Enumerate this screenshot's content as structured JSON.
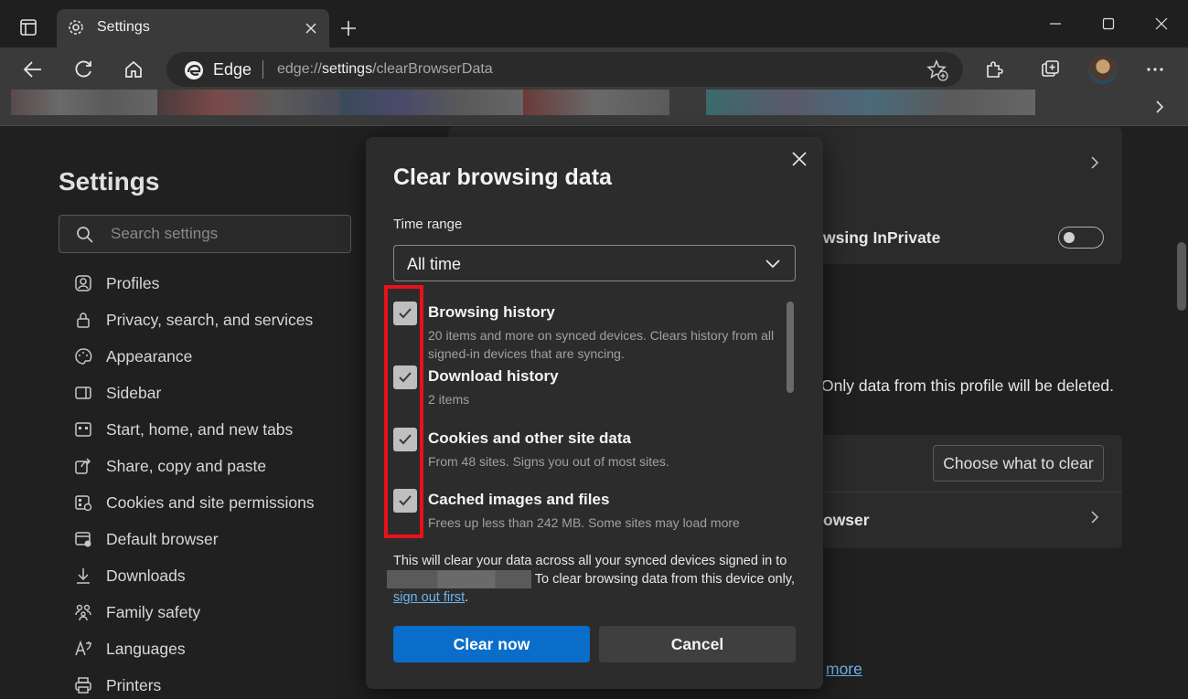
{
  "tab": {
    "title": "Settings"
  },
  "address_bar": {
    "site_name": "Edge",
    "url_prefix": "edge://",
    "url_path": "settings",
    "url_suffix": "/clearBrowserData"
  },
  "sidebar": {
    "title": "Settings",
    "search_placeholder": "Search settings",
    "items": [
      {
        "label": "Profiles",
        "icon": "profile-icon"
      },
      {
        "label": "Privacy, search, and services",
        "icon": "lock-icon"
      },
      {
        "label": "Appearance",
        "icon": "palette-icon"
      },
      {
        "label": "Sidebar",
        "icon": "sidebar-icon"
      },
      {
        "label": "Start, home, and new tabs",
        "icon": "home-grid-icon"
      },
      {
        "label": "Share, copy and paste",
        "icon": "share-icon"
      },
      {
        "label": "Cookies and site permissions",
        "icon": "cookies-icon"
      },
      {
        "label": "Default browser",
        "icon": "browser-icon"
      },
      {
        "label": "Downloads",
        "icon": "download-icon"
      },
      {
        "label": "Family safety",
        "icon": "family-icon"
      },
      {
        "label": "Languages",
        "icon": "language-icon"
      },
      {
        "label": "Printers",
        "icon": "printer-icon"
      }
    ]
  },
  "background": {
    "inprivate_label": "wsing InPrivate",
    "profile_note": "Only data from this profile will be deleted.",
    "choose_button": "Choose what to clear",
    "browser_row": "owser",
    "more_link": "more"
  },
  "dialog": {
    "title": "Clear browsing data",
    "time_range_label": "Time range",
    "time_range_value": "All time",
    "items": [
      {
        "title": "Browsing history",
        "desc": "20 items and more on synced devices. Clears history from all signed-in devices that are syncing.",
        "checked": true
      },
      {
        "title": "Download history",
        "desc": "2 items",
        "checked": true
      },
      {
        "title": "Cookies and other site data",
        "desc": "From 48 sites. Signs you out of most sites.",
        "checked": true
      },
      {
        "title": "Cached images and files",
        "desc": "Frees up less than 242 MB. Some sites may load more",
        "checked": true
      }
    ],
    "note_part1": "This will clear your data across all your synced devices signed in to",
    "note_part2": "To clear browsing data from this device only,",
    "note_link": "sign out first",
    "note_end": ".",
    "clear_button": "Clear now",
    "cancel_button": "Cancel"
  },
  "colors": {
    "accent": "#0a6dc9",
    "highlight": "#e8121a",
    "link": "#6cb4ee"
  }
}
